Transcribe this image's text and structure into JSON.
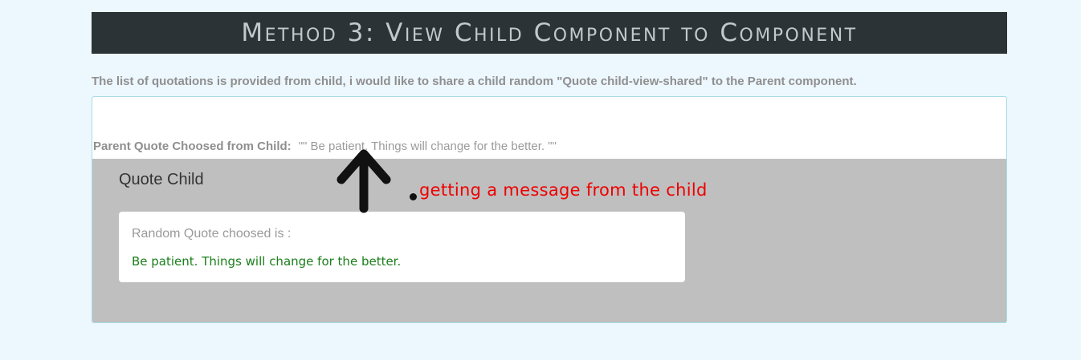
{
  "banner": {
    "title": "Method 3: View Child Component to Component"
  },
  "intro": {
    "text": "The list of quotations is provided from child, i would like to share a child random \"Quote child-view-shared\" to the Parent component."
  },
  "parent": {
    "label": "Parent Quote Choosed from Child:",
    "value": "\"\" Be patient. Things will change for the better. \"\""
  },
  "child": {
    "title": "Quote Child",
    "card_label": "Random Quote choosed is :",
    "card_quote": "Be patient. Things will change for the better."
  },
  "annotation": {
    "text": "getting a message from the child"
  },
  "colors": {
    "page_bg": "#edf7fe",
    "banner_bg": "#2b3337",
    "child_bg": "#bfbfbf",
    "quote_green": "#1a7f1a",
    "annotation_red": "#ee0000"
  },
  "icons": {
    "arrow": "arrow-up-icon"
  }
}
